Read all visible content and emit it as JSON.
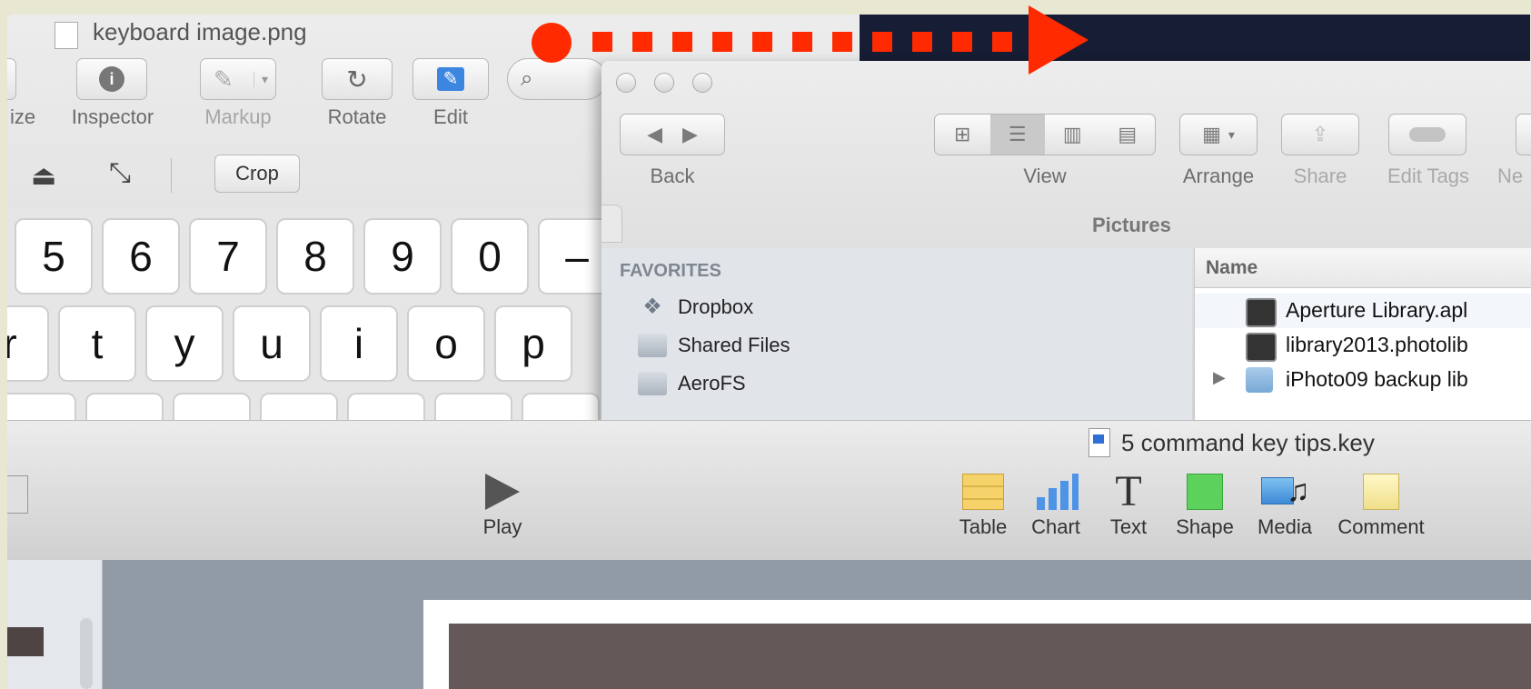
{
  "preview": {
    "title": "keyboard image.png",
    "toolbar": {
      "partial_label": "ize",
      "inspector_label": "Inspector",
      "markup_label": "Markup",
      "rotate_label": "Rotate",
      "edit_label": "Edit",
      "crop_label": "Crop"
    },
    "keyboard": {
      "number_row": [
        "5",
        "6",
        "7",
        "8",
        "9",
        "0",
        "–"
      ],
      "letter_row": [
        "r",
        "t",
        "y",
        "u",
        "i",
        "o",
        "p"
      ]
    }
  },
  "finder": {
    "toolbar": {
      "back_label": "Back",
      "view_label": "View",
      "arrange_label": "Arrange",
      "share_label": "Share",
      "edit_tags_label": "Edit Tags",
      "new_partial_label": "Ne"
    },
    "path_title": "Pictures",
    "sidebar": {
      "header": "FAVORITES",
      "items": [
        {
          "label": "Dropbox"
        },
        {
          "label": "Shared Files"
        },
        {
          "label": "AeroFS"
        }
      ]
    },
    "filelist": {
      "name_header": "Name",
      "rows": [
        {
          "name": "Aperture Library.apl"
        },
        {
          "name": "library2013.photolib"
        },
        {
          "name": "iPhoto09 backup lib"
        }
      ]
    }
  },
  "keynote": {
    "doc_title": "5 command key tips.key",
    "play_label": "Play",
    "tools": {
      "table": "Table",
      "chart": "Chart",
      "text": "Text",
      "shape": "Shape",
      "media": "Media",
      "comment": "Comment"
    }
  },
  "colors": {
    "arrow": "#ff2a00",
    "dark_bar": "#161d34",
    "slide_dark": "#655858"
  }
}
